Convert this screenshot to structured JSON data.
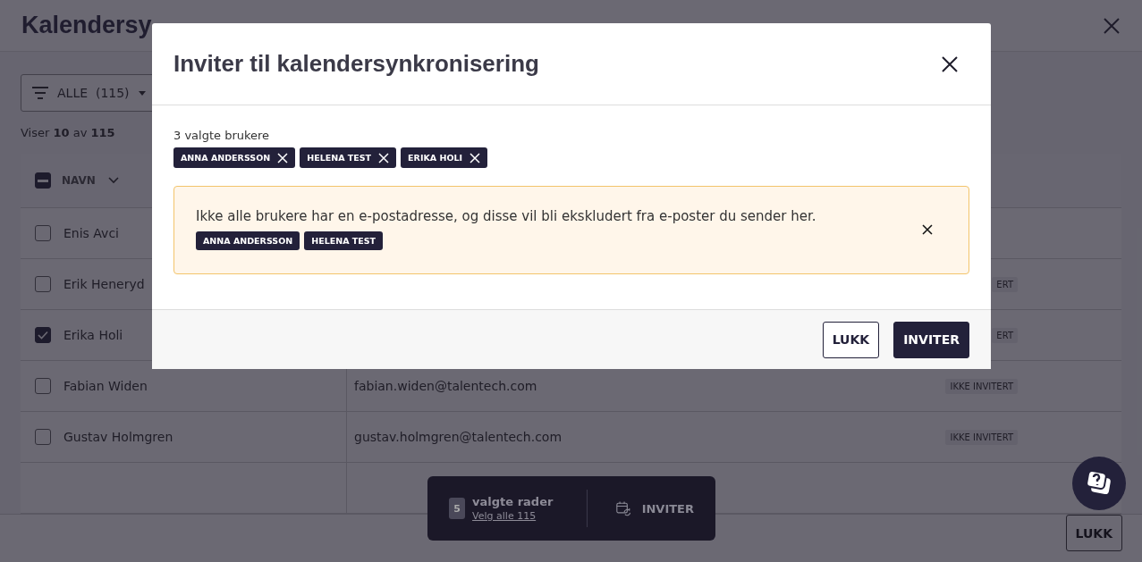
{
  "page": {
    "title": "Kalendersy",
    "filter": {
      "label": "ALLE",
      "count": "(115)"
    },
    "showing": "Viser **10** av **115**",
    "table": {
      "header": {
        "indeterminate": true,
        "column": "NAVN"
      },
      "rows": [
        {
          "name": "Enis Avci",
          "checked": false
        },
        {
          "name": "Erik Heneryd",
          "checked": false,
          "status": "ERT"
        },
        {
          "name": "Erika Holi",
          "checked": true,
          "status": "ERT"
        },
        {
          "name": "Fabian Widen",
          "checked": false,
          "email": "fabian.widen@talentech.com",
          "status": "IKKE INVITERT"
        },
        {
          "name": "Gustav Holmgren",
          "checked": false,
          "email": "gustav.holmgren@talentech.com",
          "status": "IKKE INVITERT"
        }
      ]
    },
    "close_button": "LUKK"
  },
  "selection_bar": {
    "count": "5",
    "label": "valgte rader",
    "select_all": "Velg alle 115",
    "action": "INVITER"
  },
  "dialog": {
    "title": "Inviter til kalendersynkronisering",
    "selected_label": "3 valgte brukere",
    "chips": [
      "ANNA ANDERSSON",
      "HELENA TEST",
      "ERIKA HOLI"
    ],
    "warning": {
      "message": "Ikke alle brukere har en e-postadresse, og disse vil bli ekskludert fra e-poster du sender her.",
      "tags": [
        "ANNA ANDERSSON",
        "HELENA TEST"
      ]
    },
    "buttons": [
      {
        "label": "LUKK",
        "kind": "secondary"
      },
      {
        "label": "INVITER",
        "kind": "primary"
      }
    ]
  }
}
